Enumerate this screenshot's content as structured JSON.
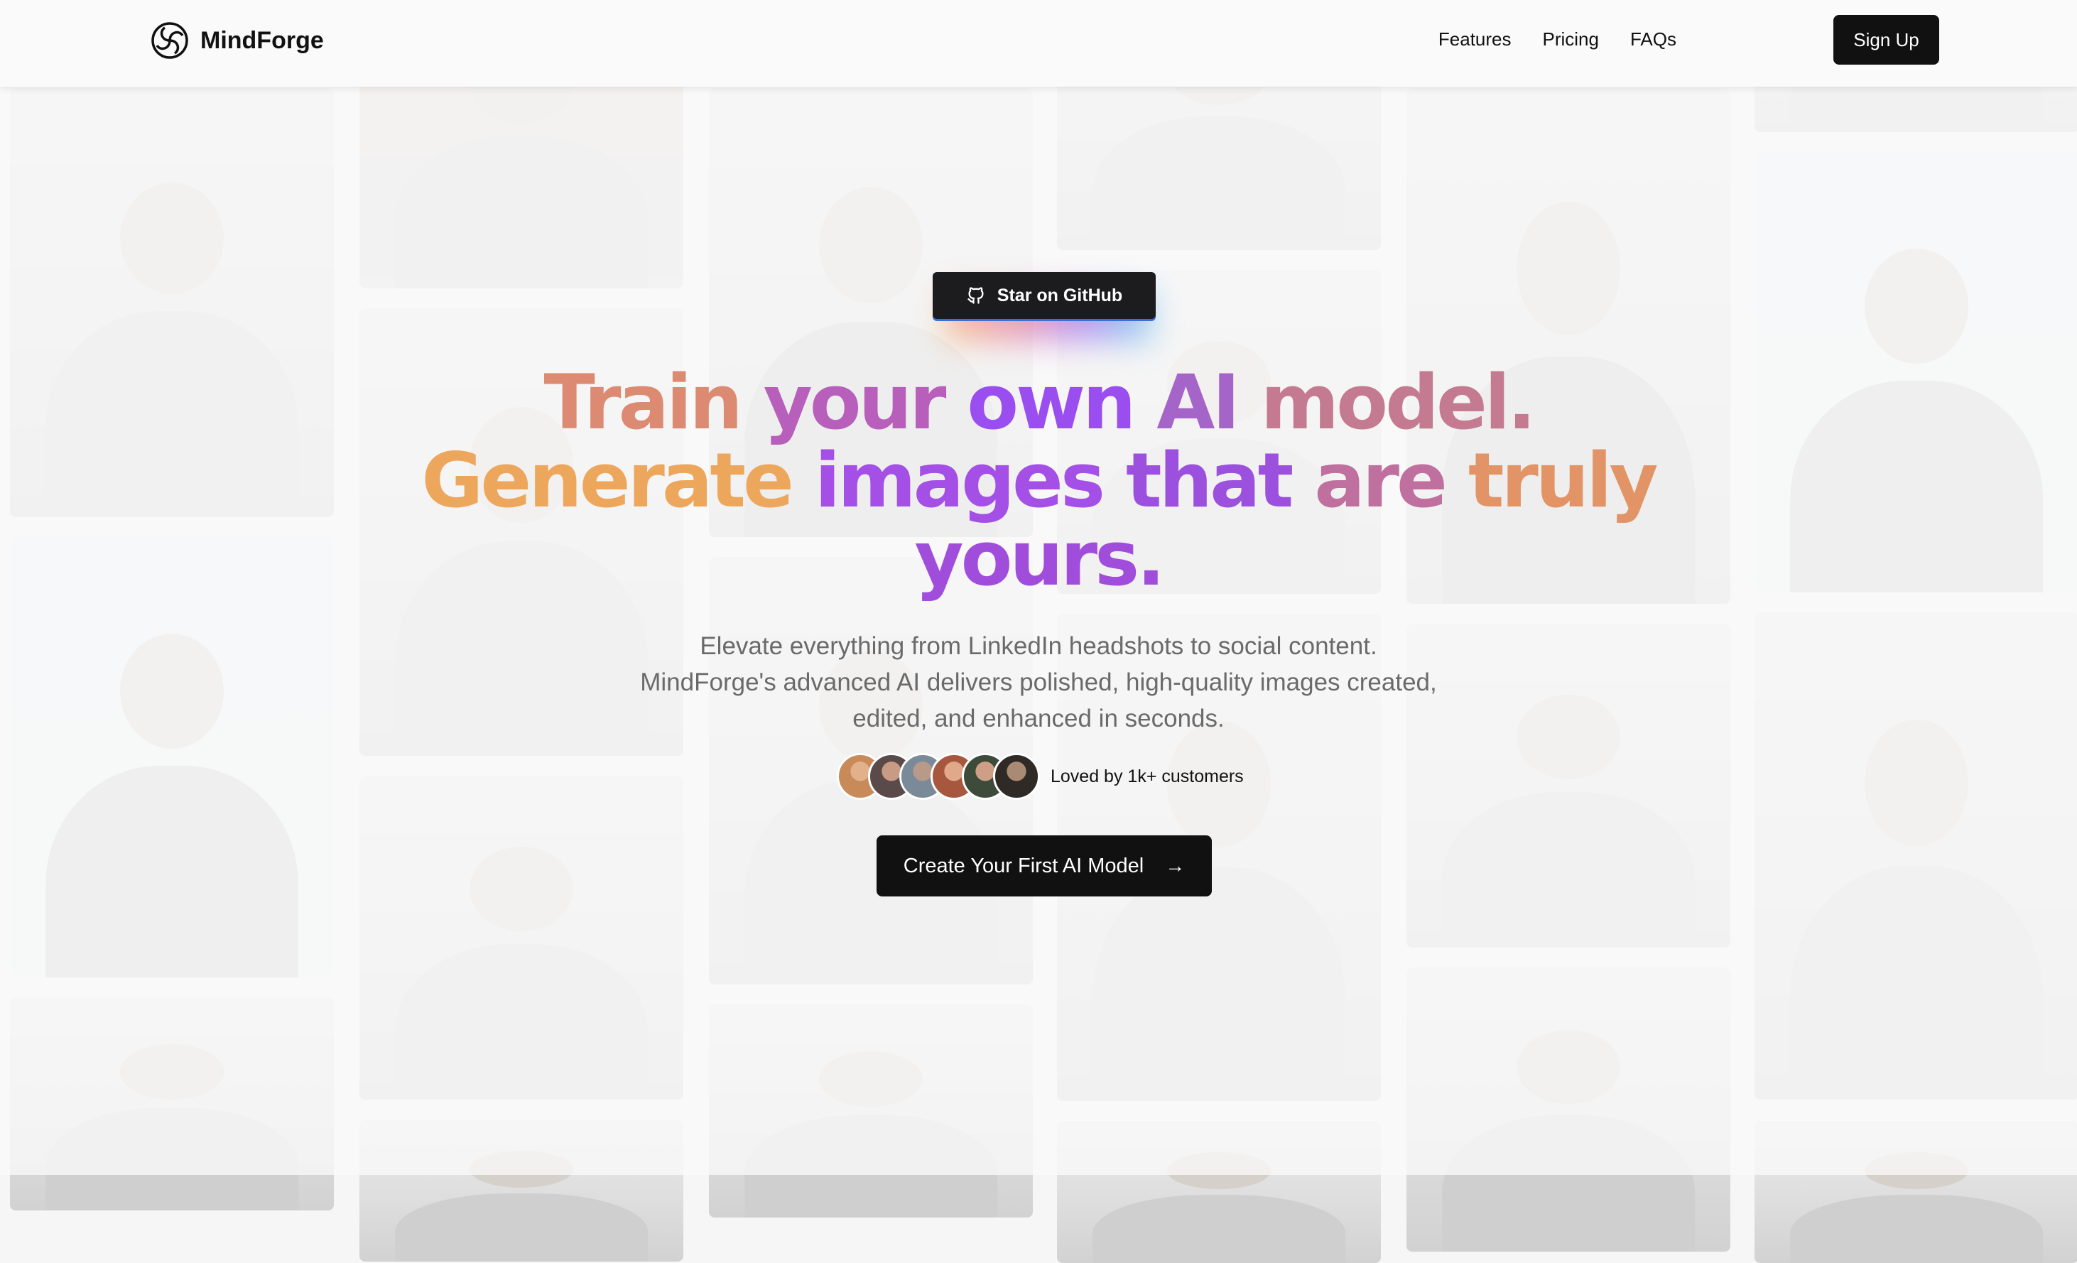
{
  "nav": {
    "brand": "MindForge",
    "links": [
      "Features",
      "Pricing",
      "FAQs"
    ],
    "signup_label": "Sign Up"
  },
  "hero": {
    "github_label": "Star on GitHub",
    "headline": {
      "line1": [
        "Train",
        "your",
        "own",
        "AI",
        "model."
      ],
      "line2": [
        "Generate",
        "images",
        "that",
        "are",
        "truly"
      ],
      "line3": [
        "yours."
      ]
    },
    "subtitle": {
      "line1": "Elevate everything from LinkedIn headshots to social content.",
      "line2": "MindForge's advanced AI delivers polished, high-quality images created,",
      "line3": "edited, and enhanced in seconds."
    },
    "social_proof": "Loved by 1k+ customers",
    "cta_label": "Create Your First AI Model",
    "cta_icon": "arrow-right-icon"
  },
  "colors": {
    "headline_orange": "#eda75c",
    "headline_purple": "#9b4ef0",
    "headline_pink": "#c47a90",
    "button_dark": "#111111"
  },
  "avatar_colors": [
    "#c98a5a",
    "#5a4a4a",
    "#7b8a98",
    "#a8573f",
    "#3d4b3a",
    "#2f2a26"
  ]
}
